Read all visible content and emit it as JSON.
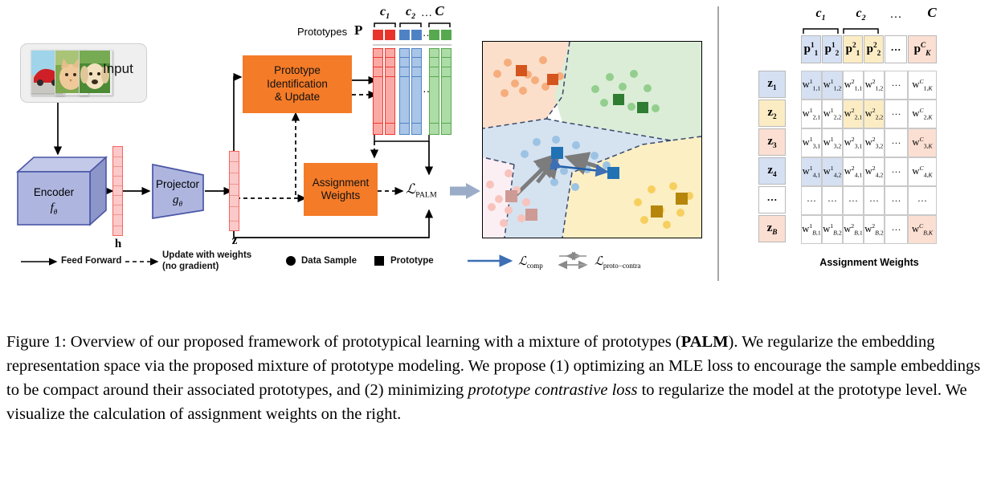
{
  "figure": {
    "input": {
      "label": "Input",
      "photos": [
        "red-sports-car",
        "kitten",
        "golden-retriever-dog"
      ]
    },
    "encoder": {
      "label": "Encoder",
      "sublabel": "fθ"
    },
    "projector": {
      "label": "Projector",
      "sublabel": "gθ"
    },
    "vectors": {
      "h_label": "h",
      "z_label": "z"
    },
    "boxes": {
      "prototype_update": "Prototype\nIdentification\n& Update",
      "assignment_weights": "Assignment\nWeights"
    },
    "prototypes": {
      "caption": "Prototypes",
      "symbol": "P",
      "class_labels": [
        "c₁",
        "c₂",
        "⋯",
        "C"
      ],
      "ellipsis": "⋯",
      "colors": {
        "class1": "#E8342C",
        "class2": "#4F82C4",
        "classC": "#57A94F"
      }
    },
    "loss_label": "ℒPALM",
    "legend": [
      {
        "name": "feed-forward",
        "text": "Feed Forward",
        "style": "solid-arrow",
        "color": "#000000"
      },
      {
        "name": "update-with-weights",
        "text": "Update with weights\n(no gradient)",
        "style": "dashed-arrow",
        "color": "#000000"
      },
      {
        "name": "data-sample",
        "text": "Data Sample",
        "style": "circle",
        "color": "#000000"
      },
      {
        "name": "prototype",
        "text": "Prototype",
        "style": "square",
        "color": "#000000"
      },
      {
        "name": "loss-comp",
        "text": "ℒcomp",
        "style": "solid-arrow",
        "color": "#3D6FB5"
      },
      {
        "name": "loss-proto-contra",
        "text": "ℒproto−contra",
        "style": "double-arrow",
        "color": "#9a9a9a"
      }
    ],
    "scatter": {
      "clusters": [
        {
          "name": "orange",
          "dot_color": "#F6AD7C",
          "proto_color": "#D4561E",
          "region_color": "#FBDFCB"
        },
        {
          "name": "green",
          "dot_color": "#93CE8E",
          "proto_color": "#2E7D32",
          "region_color": "#DBEDD7"
        },
        {
          "name": "blue",
          "dot_color": "#9CC3E4",
          "proto_color": "#2171B5",
          "region_color": "#D5E2F0"
        },
        {
          "name": "pink",
          "dot_color": "#F8C3BC",
          "proto_color": "#CE9A96",
          "region_color": "#FCEFF4"
        },
        {
          "name": "yellow",
          "dot_color": "#F7CF5E",
          "proto_color": "#B5860B",
          "region_color": "#FCEFC4"
        }
      ]
    },
    "table": {
      "title": "Assignment Weights",
      "class_groups": [
        "c₁",
        "c₂",
        "⋯",
        "C"
      ],
      "col_headers": [
        {
          "text": "p₁¹",
          "tint": "bl"
        },
        {
          "text": "p₂¹",
          "tint": "bl"
        },
        {
          "text": "p₁²",
          "tint": "yl"
        },
        {
          "text": "p₂²",
          "tint": "yl"
        },
        {
          "text": "⋯",
          "tint": ""
        },
        {
          "text": "p_K^C",
          "tint": "pk"
        }
      ],
      "row_headers": [
        {
          "text": "z₁",
          "tint": "bl"
        },
        {
          "text": "z₂",
          "tint": "yl"
        },
        {
          "text": "z₃",
          "tint": "pk"
        },
        {
          "text": "z₄",
          "tint": "bl"
        },
        {
          "text": "⋯",
          "tint": ""
        },
        {
          "text": "z_B",
          "tint": "pk"
        }
      ],
      "rows": [
        {
          "cells": [
            "w¹_{1,1}",
            "w¹_{1,2}",
            "w²_{1,1}",
            "w²_{1,2}",
            "⋯",
            "w^C_{1,K}"
          ],
          "tints": [
            "bl",
            "bl",
            "",
            "",
            "",
            ""
          ]
        },
        {
          "cells": [
            "w¹_{2,1}",
            "w¹_{2,2}",
            "w²_{2,1}",
            "w²_{2,2}",
            "⋯",
            "w^C_{2,K}"
          ],
          "tints": [
            "",
            "",
            "yl",
            "yl",
            "",
            ""
          ]
        },
        {
          "cells": [
            "w¹_{3,1}",
            "w¹_{3,2}",
            "w²_{3,1}",
            "w²_{3,2}",
            "⋯",
            "w^C_{3,K}"
          ],
          "tints": [
            "",
            "",
            "",
            "",
            "",
            "pk"
          ]
        },
        {
          "cells": [
            "w¹_{4,1}",
            "w¹_{4,2}",
            "w²_{4,1}",
            "w²_{4,2}",
            "⋯",
            "w^C_{4,K}"
          ],
          "tints": [
            "bl",
            "bl",
            "",
            "",
            "",
            ""
          ]
        },
        {
          "cells": [
            "⋯",
            "⋯",
            "⋯",
            "⋯",
            "⋯",
            "⋯"
          ],
          "tints": [
            "",
            "",
            "",
            "",
            "",
            ""
          ]
        },
        {
          "cells": [
            "w¹_{B,1}",
            "w¹_{B,2}",
            "w²_{B,1}",
            "w²_{B,2}",
            "⋯",
            "w^C_{B,K}"
          ],
          "tints": [
            "",
            "",
            "",
            "",
            "",
            "pk"
          ]
        }
      ]
    }
  },
  "caption": {
    "prefix": "Figure 1: Overview of our proposed framework of prototypical learning with a mixture of prototypes (",
    "bold1": "PALM",
    "mid1": "). We regularize the embedding representation space via the proposed mixture of prototype modeling. We propose (1) optimizing an MLE loss to encourage the sample embeddings to be compact around their associated prototypes, and (2) minimizing ",
    "italic1": "prototype contrastive loss",
    "tail": " to regularize the model at the prototype level. We visualize the calculation of assignment weights on the right."
  }
}
